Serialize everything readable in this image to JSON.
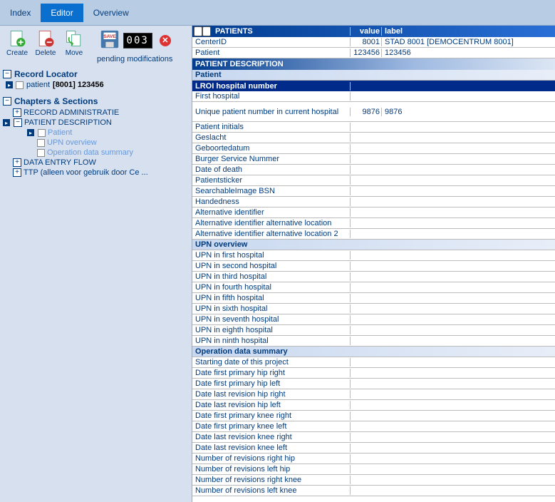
{
  "tabs": {
    "index": "Index",
    "editor": "Editor",
    "overview": "Overview"
  },
  "toolbar": {
    "create": "Create",
    "delete": "Delete",
    "move": "Move",
    "save": "SAVE",
    "counter": "003",
    "pending": "pending modifications"
  },
  "locator": {
    "title": "Record Locator",
    "label": "patient",
    "value": "[8001] 123456"
  },
  "chapters": {
    "title": "Chapters & Sections",
    "items": [
      {
        "label": "RECORD ADMINISTRATIE",
        "box": "+"
      },
      {
        "label": "PATIENT DESCRIPTION",
        "box": "−",
        "arrow": true
      },
      {
        "label": "Patient",
        "cb": true,
        "light": true,
        "indent": 3,
        "arrow": true
      },
      {
        "label": "UPN overview",
        "cb": true,
        "light": true,
        "indent": 3
      },
      {
        "label": "Operation data summary",
        "cb": true,
        "light": true,
        "indent": 3
      },
      {
        "label": "DATA ENTRY FLOW",
        "box": "+"
      },
      {
        "label": "TTP (alleen voor gebruik door Ce ...",
        "box": "+"
      }
    ]
  },
  "grid": {
    "headers": {
      "name": "PATIENTS",
      "value": "value",
      "label": "label"
    },
    "rows": [
      {
        "type": "data",
        "name": "CenterID",
        "value": "8001",
        "label": "STAD 8001 [DEMOCENTRUM 8001]"
      },
      {
        "type": "data",
        "name": "Patient",
        "value": "123456",
        "label": "123456"
      },
      {
        "type": "section",
        "name": "PATIENT DESCRIPTION"
      },
      {
        "type": "subblue",
        "name": "Patient"
      },
      {
        "type": "selected",
        "name": "LROI hospital number"
      },
      {
        "type": "data",
        "name": "First hospital"
      },
      {
        "type": "data",
        "name": "Unique patient number in current hospital",
        "value": "9876",
        "label": "9876",
        "tall": true
      },
      {
        "type": "data",
        "name": "Patient initials"
      },
      {
        "type": "data",
        "name": "Geslacht"
      },
      {
        "type": "data",
        "name": "Geboortedatum"
      },
      {
        "type": "data",
        "name": "Burger Service Nummer"
      },
      {
        "type": "data",
        "name": "Date of death"
      },
      {
        "type": "data",
        "name": "Patientsticker"
      },
      {
        "type": "data",
        "name": "SearchableImage BSN"
      },
      {
        "type": "data",
        "name": "Handedness"
      },
      {
        "type": "data",
        "name": "Alternative identifier"
      },
      {
        "type": "data",
        "name": "Alternative identifier alternative location"
      },
      {
        "type": "data",
        "name": "Alternative identifier alternative location 2"
      },
      {
        "type": "subblue",
        "name": "UPN overview"
      },
      {
        "type": "data",
        "name": "UPN in first hospital"
      },
      {
        "type": "data",
        "name": "UPN in second hospital"
      },
      {
        "type": "data",
        "name": "UPN in third hospital"
      },
      {
        "type": "data",
        "name": "UPN in fourth hospital"
      },
      {
        "type": "data",
        "name": "UPN in fifth hospital"
      },
      {
        "type": "data",
        "name": "UPN in sixth hospital"
      },
      {
        "type": "data",
        "name": "UPN in seventh hospital"
      },
      {
        "type": "data",
        "name": "UPN in eighth hospital"
      },
      {
        "type": "data",
        "name": "UPN in ninth hospital"
      },
      {
        "type": "subblue",
        "name": "Operation data summary"
      },
      {
        "type": "data",
        "name": "Starting date of this project"
      },
      {
        "type": "data",
        "name": "Date first primary hip right"
      },
      {
        "type": "data",
        "name": "Date first primary hip left"
      },
      {
        "type": "data",
        "name": "Date last revision hip right"
      },
      {
        "type": "data",
        "name": "Date last revision hip left"
      },
      {
        "type": "data",
        "name": "Date first primary knee right"
      },
      {
        "type": "data",
        "name": "Date first primary knee left"
      },
      {
        "type": "data",
        "name": "Date last revision knee right"
      },
      {
        "type": "data",
        "name": "Date last revision knee left"
      },
      {
        "type": "data",
        "name": "Number of revisions right hip"
      },
      {
        "type": "data",
        "name": "Number of revisions left hip"
      },
      {
        "type": "data",
        "name": "Number of revisions right knee"
      },
      {
        "type": "data",
        "name": "Number of revisions left knee"
      }
    ]
  }
}
